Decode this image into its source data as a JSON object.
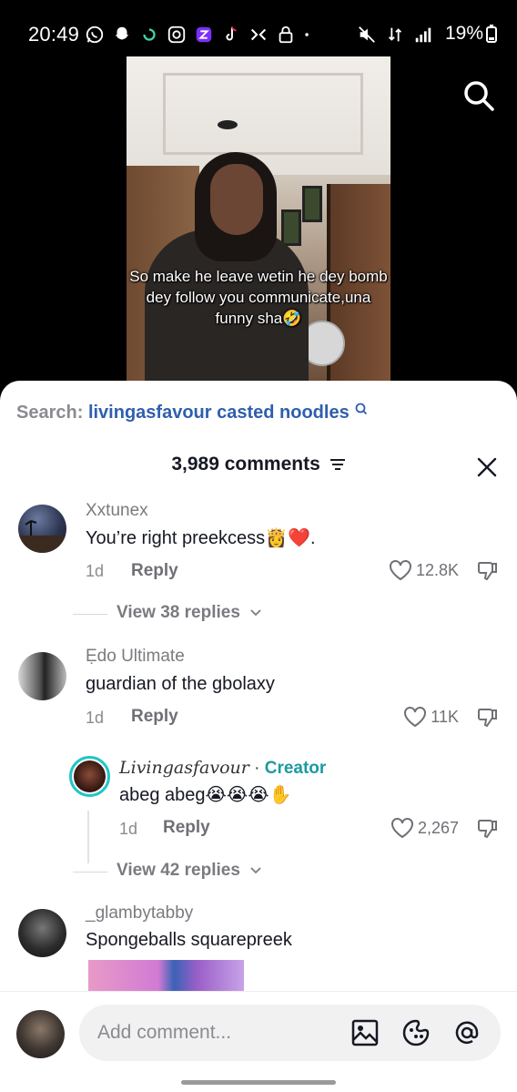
{
  "status_bar": {
    "time": "20:49",
    "battery": "19%",
    "left_icons": [
      "whatsapp-icon",
      "snapchat-icon",
      "sync-icon",
      "instagram-icon",
      "app-icon",
      "tiktok-icon",
      "game-icon",
      "lock-icon",
      "dot-icon"
    ],
    "right_icons": [
      "mute-icon",
      "data-icon",
      "signal-icon"
    ]
  },
  "video": {
    "caption": "So make he leave wetin he dey bomb dey follow you communicate,una funny sha🤣"
  },
  "sheet": {
    "search_prefix": "Search:",
    "search_query": "livingasfavour casted noodles",
    "comments_count": "3,989 comments"
  },
  "comments": [
    {
      "user": "Xxtunex",
      "text": "You’re right preekcess👸❤️.",
      "time": "1d",
      "reply_label": "Reply",
      "likes": "12.8K",
      "view_replies": "View 38 replies"
    },
    {
      "user": "Ẹdo Ultimate",
      "text": "guardian of the gbolaxy",
      "time": "1d",
      "reply_label": "Reply",
      "likes": "11K",
      "reply": {
        "user": "Livingasfavour",
        "separator": " · ",
        "creator_tag": "Creator",
        "text": "abeg abeg😭😭😭✋",
        "time": "1d",
        "reply_label": "Reply",
        "likes": "2,267"
      },
      "view_replies": "View 42 replies"
    },
    {
      "user": "_glambytabby",
      "text": "Spongeballs squarepreek"
    }
  ],
  "composer": {
    "placeholder": "Add comment..."
  },
  "colors": {
    "search_query": "#2f5fad",
    "creator_accent": "#1d9aa0",
    "creator_ring": "#21c6c6"
  }
}
